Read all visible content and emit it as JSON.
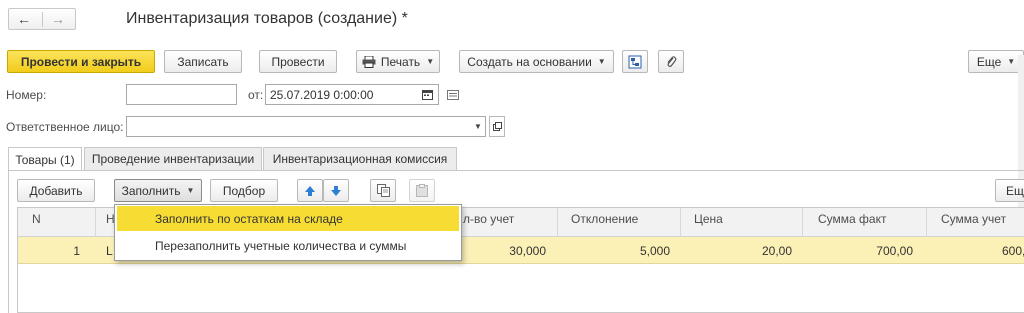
{
  "window": {
    "title": "Инвентаризация товаров (создание) *"
  },
  "toolbar": {
    "post_close": "Провести и закрыть",
    "save": "Записать",
    "post": "Провести",
    "print": "Печать",
    "create_based": "Создать на основании",
    "more": "Еще"
  },
  "form": {
    "number_label": "Номер:",
    "number_value": "",
    "date_label": "от:",
    "date_value": "25.07.2019  0:00:00",
    "responsible_label": "Ответственное лицо:",
    "responsible_value": ""
  },
  "tabs": [
    {
      "label": "Товары (1)",
      "active": true
    },
    {
      "label": "Проведение инвентаризации",
      "active": false
    },
    {
      "label": "Инвентаризационная комиссия",
      "active": false
    }
  ],
  "table_toolbar": {
    "add": "Добавить",
    "fill": "Заполнить",
    "selection": "Подбор",
    "more": "Ещ"
  },
  "dropdown": {
    "items": [
      "Заполнить по остаткам на складе",
      "Перезаполнить учетные количества и суммы"
    ]
  },
  "table": {
    "headers": [
      "N",
      "Н",
      "л-во учет",
      "Отклонение",
      "Цена",
      "Сумма факт",
      "Сумма учет"
    ],
    "rows": [
      {
        "n": "1",
        "name": "L",
        "qty_account": "30,000",
        "deviation": "5,000",
        "price": "20,00",
        "sum_fact": "700,00",
        "sum_account": "600,0"
      }
    ]
  },
  "colors": {
    "accent_yellow": "#f2cc1c",
    "row_highlight": "#fbf1b7",
    "menu_highlight": "#f7dd33",
    "arrow_blue": "#2d7fd6"
  }
}
